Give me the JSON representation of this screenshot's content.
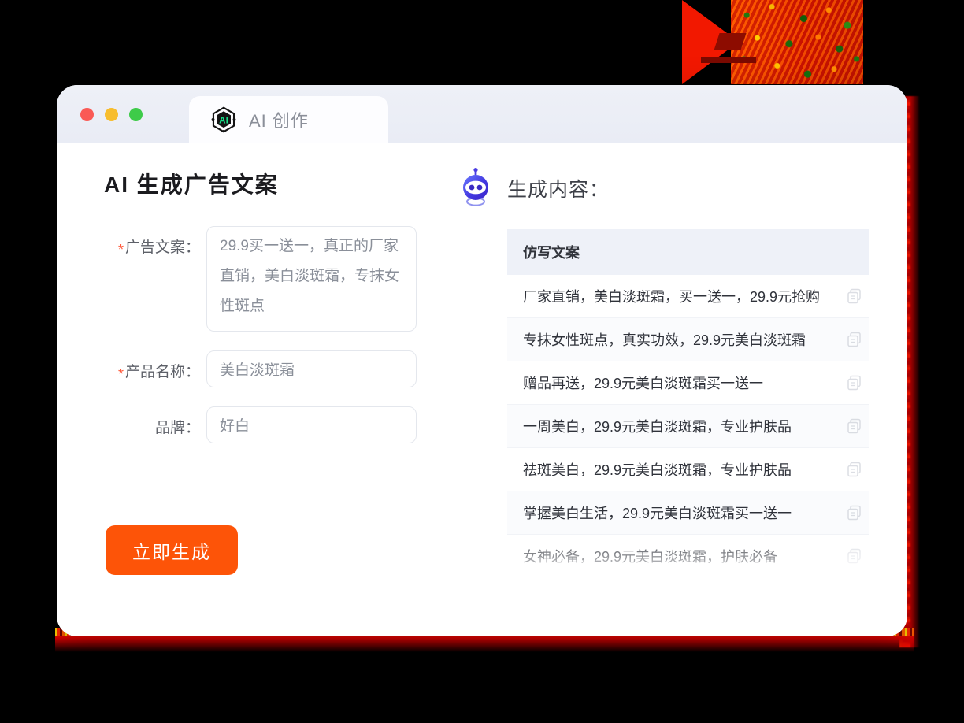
{
  "window": {
    "traffic_lights": [
      {
        "name": "close",
        "color": "#fa5a55"
      },
      {
        "name": "minimize",
        "color": "#f7bd2e"
      },
      {
        "name": "maximize",
        "color": "#3ecb49"
      }
    ],
    "tab": {
      "label": "AI 创作",
      "logo_text": "AI",
      "logo_icon": "ai-hexagon-logo"
    }
  },
  "left": {
    "title": "AI 生成广告文案",
    "fields": [
      {
        "label": "广告文案：",
        "required": true,
        "value": "29.9买一送一，真正的厂家直销，美白淡斑霜，专抹女性斑点",
        "type": "textarea"
      },
      {
        "label": "产品名称：",
        "required": true,
        "value": "美白淡斑霜",
        "type": "text"
      },
      {
        "label": "品牌：",
        "required": false,
        "value": "好白",
        "type": "text"
      }
    ],
    "submit_label": "立即生成",
    "submit_color": "#fd5408"
  },
  "right": {
    "heading": "生成内容：",
    "heading_icon": "robot-icon",
    "table": {
      "column_header": "仿写文案",
      "copy_icon": "copy-icon",
      "rows": [
        {
          "index": "1",
          "text": "厂家直销，美白淡斑霜，买一送一，29.9元抢购"
        },
        {
          "index": "2",
          "text": "专抹女性斑点，真实功效，29.9元美白淡斑霜"
        },
        {
          "index": "3",
          "text": "赠品再送，29.9元美白淡斑霜买一送一"
        },
        {
          "index": "4",
          "text": "一周美白，29.9元美白淡斑霜，专业护肤品"
        },
        {
          "index": "5",
          "text": "祛斑美白，29.9元美白淡斑霜，专业护肤品"
        },
        {
          "index": "6",
          "text": "掌握美白生活，29.9元美白淡斑霜买一送一"
        },
        {
          "index": "7",
          "text": "女神必备，29.9元美白淡斑霜，护肤必备"
        }
      ]
    }
  },
  "decor": {
    "glitch_name": "glitch-graphic",
    "red_accent": "#ff2a00"
  }
}
